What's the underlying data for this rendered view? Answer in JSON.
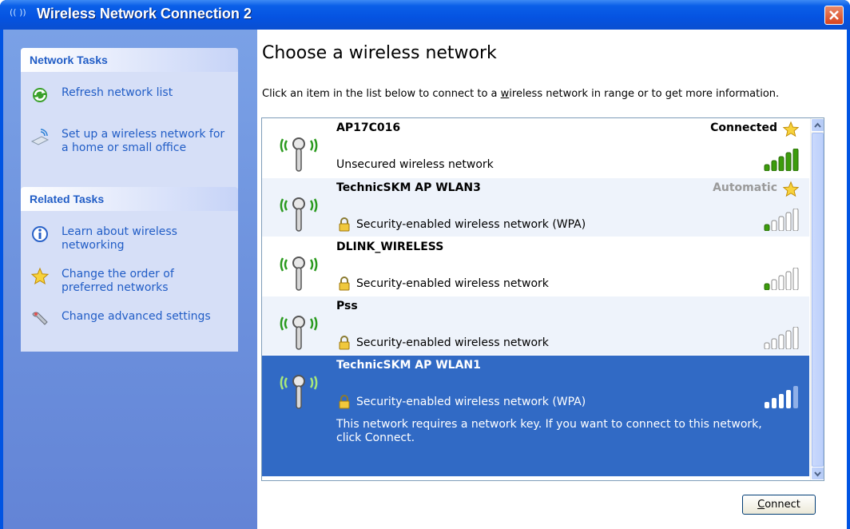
{
  "window": {
    "title": "Wireless Network Connection 2",
    "title_icon": "(( ))"
  },
  "sidebar": {
    "network_tasks": {
      "header": "Network Tasks",
      "items": [
        {
          "label": "Refresh network list",
          "icon": "refresh-icon"
        },
        {
          "label": "Set up a wireless network for a home or small office",
          "icon": "wireless-setup-icon"
        }
      ]
    },
    "related_tasks": {
      "header": "Related Tasks",
      "items": [
        {
          "label": "Learn about wireless networking",
          "icon": "info-icon"
        },
        {
          "label": "Change the order of preferred networks",
          "icon": "star-icon"
        },
        {
          "label": "Change advanced settings",
          "icon": "wrench-icon"
        }
      ]
    }
  },
  "main": {
    "heading": "Choose a wireless network",
    "intro_pre": "Click an item in the list below to connect to a ",
    "intro_link": "w",
    "intro_post": "ireless network in range or to get more information.",
    "networks": [
      {
        "ssid": "AP17C016",
        "security": "Unsecured wireless network",
        "status": "Connected",
        "signal_bars": 5,
        "locked": false,
        "selected": false
      },
      {
        "ssid": "TechnicSKM AP WLAN3",
        "security": "Security-enabled wireless network (WPA)",
        "status": "Automatic",
        "signal_bars": 1,
        "locked": true,
        "selected": false
      },
      {
        "ssid": "DLINK_WIRELESS",
        "security": "Security-enabled wireless network",
        "status": "",
        "signal_bars": 1,
        "locked": true,
        "selected": false
      },
      {
        "ssid": "Pss",
        "security": "Security-enabled wireless network",
        "status": "",
        "signal_bars": 0,
        "locked": true,
        "selected": false
      },
      {
        "ssid": "TechnicSKM AP WLAN1",
        "security": "Security-enabled wireless network (WPA)",
        "status": "",
        "signal_bars": 4,
        "locked": true,
        "selected": true,
        "detail": "This network requires a network key. If you want to connect to this network, click Connect."
      }
    ],
    "connect_button": {
      "accel": "C",
      "rest": "onnect"
    }
  },
  "colors": {
    "title_blue": "#0054e3",
    "selection": "#316ac5",
    "task_link": "#215dc6",
    "signal_green": "#3c9c0c"
  }
}
